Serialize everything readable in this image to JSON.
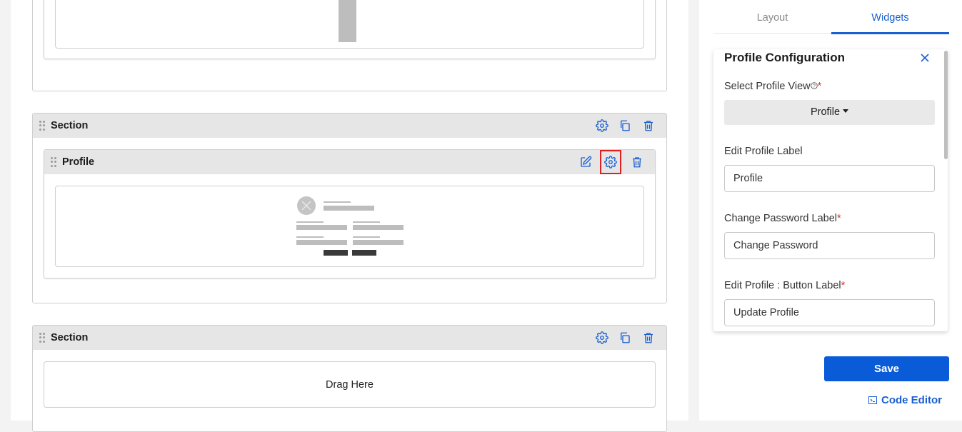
{
  "canvas": {
    "sections": [
      {
        "title": "Section",
        "widget": {
          "title": "Profile"
        }
      },
      {
        "title": "Section",
        "drop_text": "Drag Here"
      }
    ]
  },
  "panel": {
    "tabs": [
      {
        "label": "Layout",
        "active": false
      },
      {
        "label": "Widgets",
        "active": true
      }
    ],
    "config": {
      "title": "Profile Configuration",
      "fields": {
        "profile_view": {
          "label": "Select Profile View",
          "required": "*",
          "value": "Profile"
        },
        "edit_profile_label": {
          "label": "Edit Profile Label",
          "value": "Profile"
        },
        "change_password_label": {
          "label": "Change Password Label",
          "required": "*",
          "value": "Change Password"
        },
        "edit_profile_button_label": {
          "label": "Edit Profile : Button Label",
          "required": "*",
          "value": "Update Profile"
        }
      }
    },
    "save_label": "Save",
    "code_editor_label": "Code Editor"
  },
  "colors": {
    "accent": "#1a5fd0",
    "primary_button": "#0a5bd8",
    "highlight": "#e02020",
    "required": "#d9342b"
  }
}
